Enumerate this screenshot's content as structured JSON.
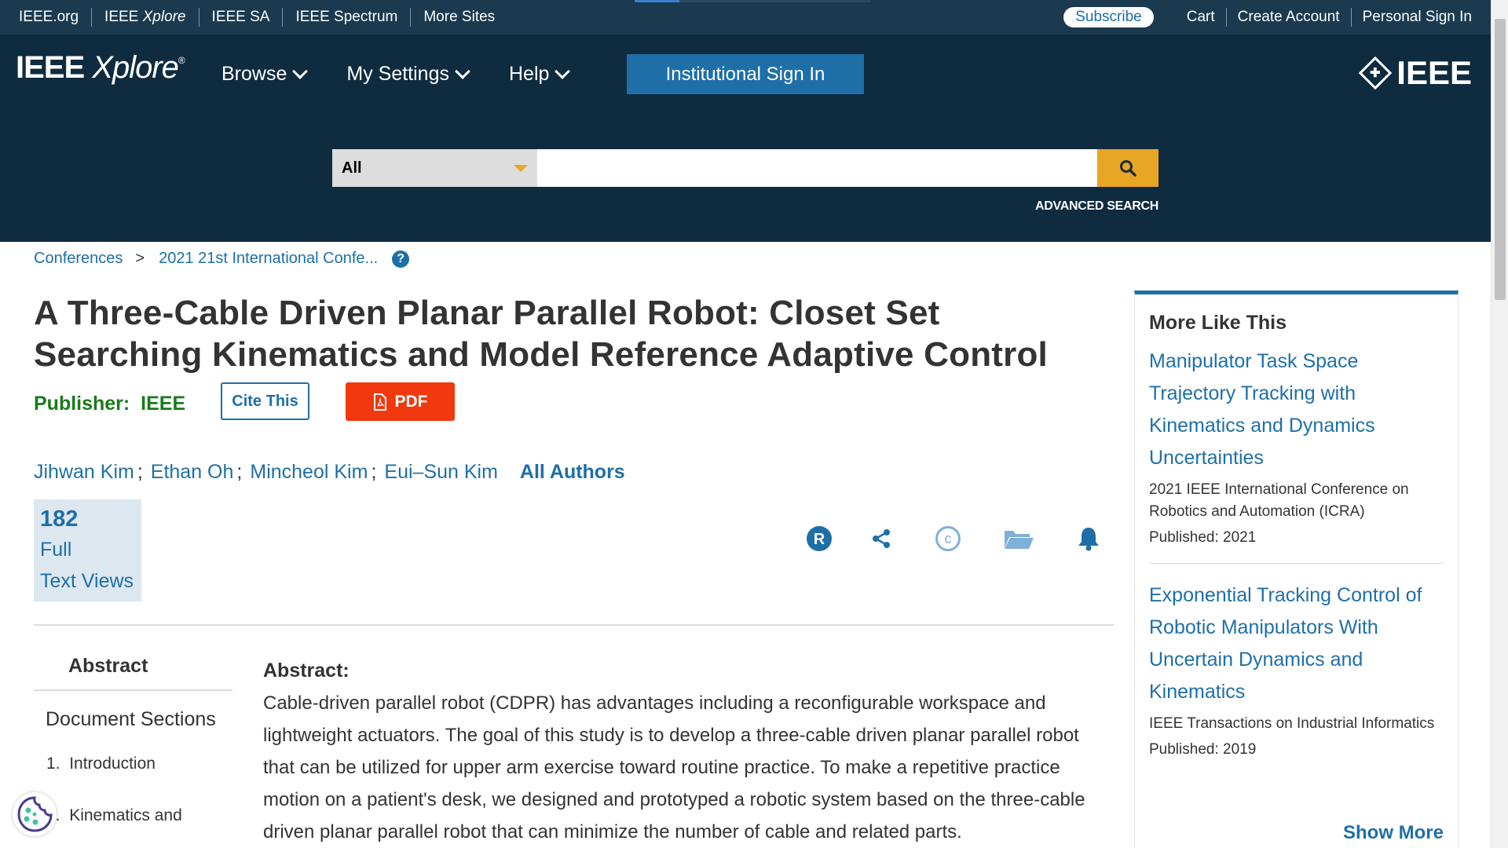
{
  "topbar": {
    "links": [
      {
        "label": "IEEE.org"
      },
      {
        "label_prefix": "IEEE ",
        "label_italic": "Xplore"
      },
      {
        "label": "IEEE SA"
      },
      {
        "label": "IEEE Spectrum"
      },
      {
        "label": "More Sites"
      }
    ],
    "subscribe": "Subscribe",
    "right_links": [
      "Cart",
      "Create Account",
      "Personal Sign In"
    ]
  },
  "header": {
    "logo_ieee": "IEEE",
    "logo_xplore": "Xplore",
    "logo_reg": "®",
    "nav": [
      "Browse",
      "My Settings",
      "Help"
    ],
    "institutional_sign_in": "Institutional Sign In",
    "ieee_brand": "IEEE"
  },
  "search": {
    "scope": "All",
    "query": "",
    "advanced": "ADVANCED SEARCH",
    "accent": "#e8a624"
  },
  "breadcrumb": {
    "items": [
      "Conferences",
      "2021 21st International Confe..."
    ],
    "separator": ">",
    "help": "?"
  },
  "article": {
    "title": "A Three-Cable Driven Planar Parallel Robot: Closet Set Searching Kinematics and Model Reference Adaptive Control",
    "publisher_label": "Publisher:",
    "publisher": "IEEE",
    "cite_button": "Cite This",
    "pdf_button": "PDF",
    "authors": [
      "Jihwan Kim",
      "Ethan Oh",
      "Mincheol Kim",
      "Eui–Sun Kim"
    ],
    "author_separator": ";",
    "all_authors": "All Authors",
    "views_count": "182",
    "views_label_1": "Full",
    "views_label_2": "Text Views"
  },
  "action_icons": [
    "rights-icon",
    "share-icon",
    "copyright-icon",
    "folder-icon",
    "alert-bell-icon"
  ],
  "left_nav": {
    "abstract_tab": "Abstract",
    "document_sections": "Document Sections",
    "sections": [
      {
        "num": "1.",
        "label": "Introduction"
      },
      {
        "num": "2.",
        "label": "Kinematics and"
      }
    ]
  },
  "abstract": {
    "heading": "Abstract:",
    "text": "Cable-driven parallel robot (CDPR) has advantages including a reconfigurable workspace and lightweight actuators. The goal of this study is to develop a three-cable driven planar parallel robot that can be utilized for upper arm exercise toward routine practice. To make a repetitive practice motion on a patient's desk, we designed and prototyped a robotic system based on the three-cable driven planar parallel robot that can minimize the number of cable and related parts."
  },
  "sidebar": {
    "heading": "More Like This",
    "items": [
      {
        "title": "Manipulator Task Space Trajectory Tracking with Kinematics and Dynamics Uncertainties",
        "venue": "2021 IEEE International Conference on Robotics and Automation (ICRA)",
        "published": "Published: 2021"
      },
      {
        "title": "Exponential Tracking Control of Robotic Manipulators With Uncertain Dynamics and Kinematics",
        "venue": "IEEE Transactions on Industrial Informatics",
        "published": "Published: 2019"
      }
    ],
    "show_more": "Show More"
  },
  "colors": {
    "topbar": "#1b3a4f",
    "header": "#0f2b3f",
    "link": "#1e6fa8",
    "publisher": "#1a7a1a",
    "pdf": "#f2380e"
  }
}
